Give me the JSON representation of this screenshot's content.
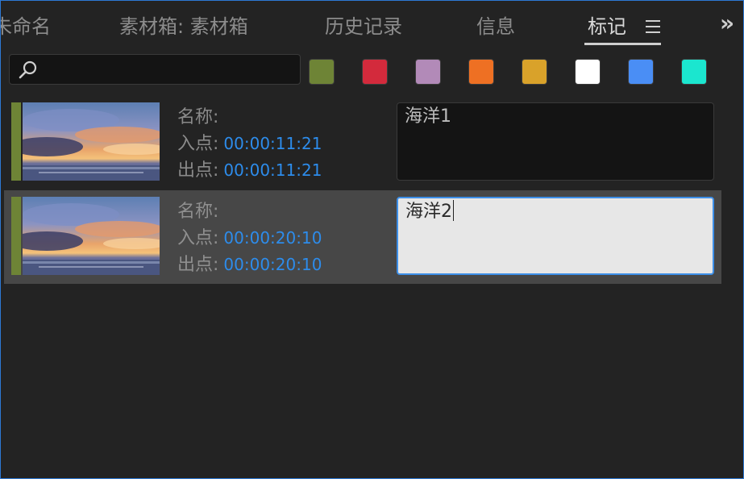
{
  "tabs": {
    "partial": "未命名",
    "bins": "素材箱: 素材箱",
    "history": "历史记录",
    "info": "信息",
    "markers": "标记",
    "menu_icon": "hamburger-icon",
    "overflow_icon": "double-chevron-right-icon"
  },
  "search": {
    "value": "",
    "placeholder": "",
    "icon": "search-icon"
  },
  "swatches": [
    {
      "name": "green",
      "color": "#6e8436"
    },
    {
      "name": "red",
      "color": "#d32a3c"
    },
    {
      "name": "violet",
      "color": "#b28ab8"
    },
    {
      "name": "orange",
      "color": "#ee7023"
    },
    {
      "name": "yellow",
      "color": "#d9a22a"
    },
    {
      "name": "white",
      "color": "#ffffff"
    },
    {
      "name": "blue",
      "color": "#4a8ef5"
    },
    {
      "name": "cyan",
      "color": "#1be6cf"
    }
  ],
  "markers": [
    {
      "color": "#6e8436",
      "name_label": "名称:",
      "in_label": "入点:",
      "in_time": "00:00:11:21",
      "out_label": "出点:",
      "out_time": "00:00:11:21",
      "comment": "海洋1"
    },
    {
      "color": "#6e8436",
      "name_label": "名称:",
      "in_label": "入点:",
      "in_time": "00:00:20:10",
      "out_label": "出点:",
      "out_time": "00:00:20:10",
      "comment": "海洋2"
    }
  ],
  "colors": {
    "accent": "#2d8ceb",
    "focus_border": "#3d8fe8",
    "panel_border": "#2d78d4"
  }
}
